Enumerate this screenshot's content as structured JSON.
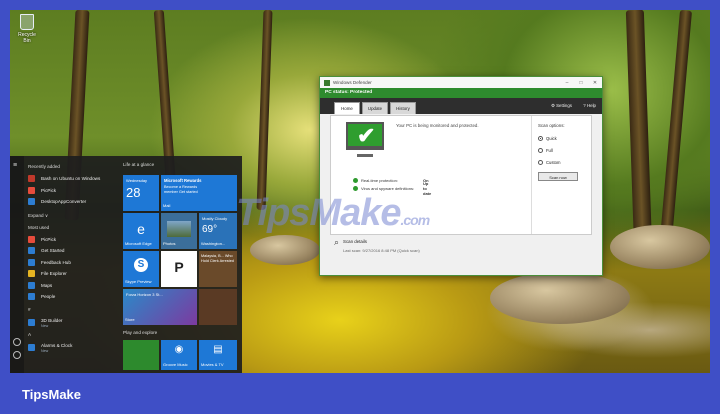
{
  "desktop": {
    "recycle_label": "Recycle Bin"
  },
  "start_menu": {
    "recent_header": "Recently added",
    "recent": [
      {
        "label": "Bash on Ubuntu on Windows",
        "color": "#c0392b"
      },
      {
        "label": "PicPick",
        "color": "#e74c3c"
      },
      {
        "label": "DesktopAppConverter",
        "color": "#2d7dd2"
      }
    ],
    "expand_label": "Expand ∨",
    "most_used_header": "Most used",
    "most_used": [
      {
        "label": "PicPick",
        "color": "#e74c3c"
      },
      {
        "label": "Get Started",
        "color": "#2d7dd2"
      },
      {
        "label": "Feedback Hub",
        "color": "#2d7dd2"
      },
      {
        "label": "File Explorer",
        "color": "#e6b422"
      },
      {
        "label": "Maps",
        "color": "#2d7dd2"
      },
      {
        "label": "People",
        "color": "#2d7dd2"
      }
    ],
    "hash_header": "#",
    "hash_item": {
      "label": "3D Builder",
      "sub": "New",
      "color": "#2d7dd2"
    },
    "a_header": "A",
    "a_item": {
      "label": "Alarms & Clock",
      "sub": "New",
      "color": "#2d7dd2"
    },
    "tiles_header": "Life at a glance",
    "play_header": "Play and explore",
    "tiles": {
      "calendar_day": "Wednesday",
      "calendar_num": "28",
      "rewards_title": "Microsoft Rewards",
      "rewards_text": "Become a Rewards member Get started",
      "mail": "Mail",
      "weather_cond": "Mostly Cloudy",
      "weather_temp": "69°",
      "weather_city": "Washington...",
      "edge": "Microsoft Edge",
      "photos": "Photos",
      "news_text": "Malaysia, B... Who Hold Clerk Arrested",
      "skype": "Skype Preview",
      "picsart": "P",
      "store": "Store",
      "forza": "Forza Horizon 3 St...",
      "movies": "Movies & TV",
      "groove": "Groove Music"
    }
  },
  "defender": {
    "title": "Windows Defender",
    "status": "PC status: Protected",
    "tabs": [
      "Home",
      "Update",
      "History"
    ],
    "settings": "Settings",
    "help": "Help",
    "status_message": "Your PC is being monitored and protected.",
    "realtime_label": "Real-time protection:",
    "realtime_value": "On",
    "defs_label": "Virus and spyware definitions:",
    "defs_value": "Up to date",
    "scan_options_header": "Scan options:",
    "scan_options": [
      "Quick",
      "Full",
      "Custom"
    ],
    "scan_button": "Scan now",
    "scan_details": "Scan details",
    "last_scan": "Last scan: 9/27/2016 8:48 PM (Quick scan)",
    "accent": "#2e8b2e"
  },
  "watermark": {
    "main": "TipsMake",
    "suffix": ".com"
  },
  "brand": "TipsMake"
}
